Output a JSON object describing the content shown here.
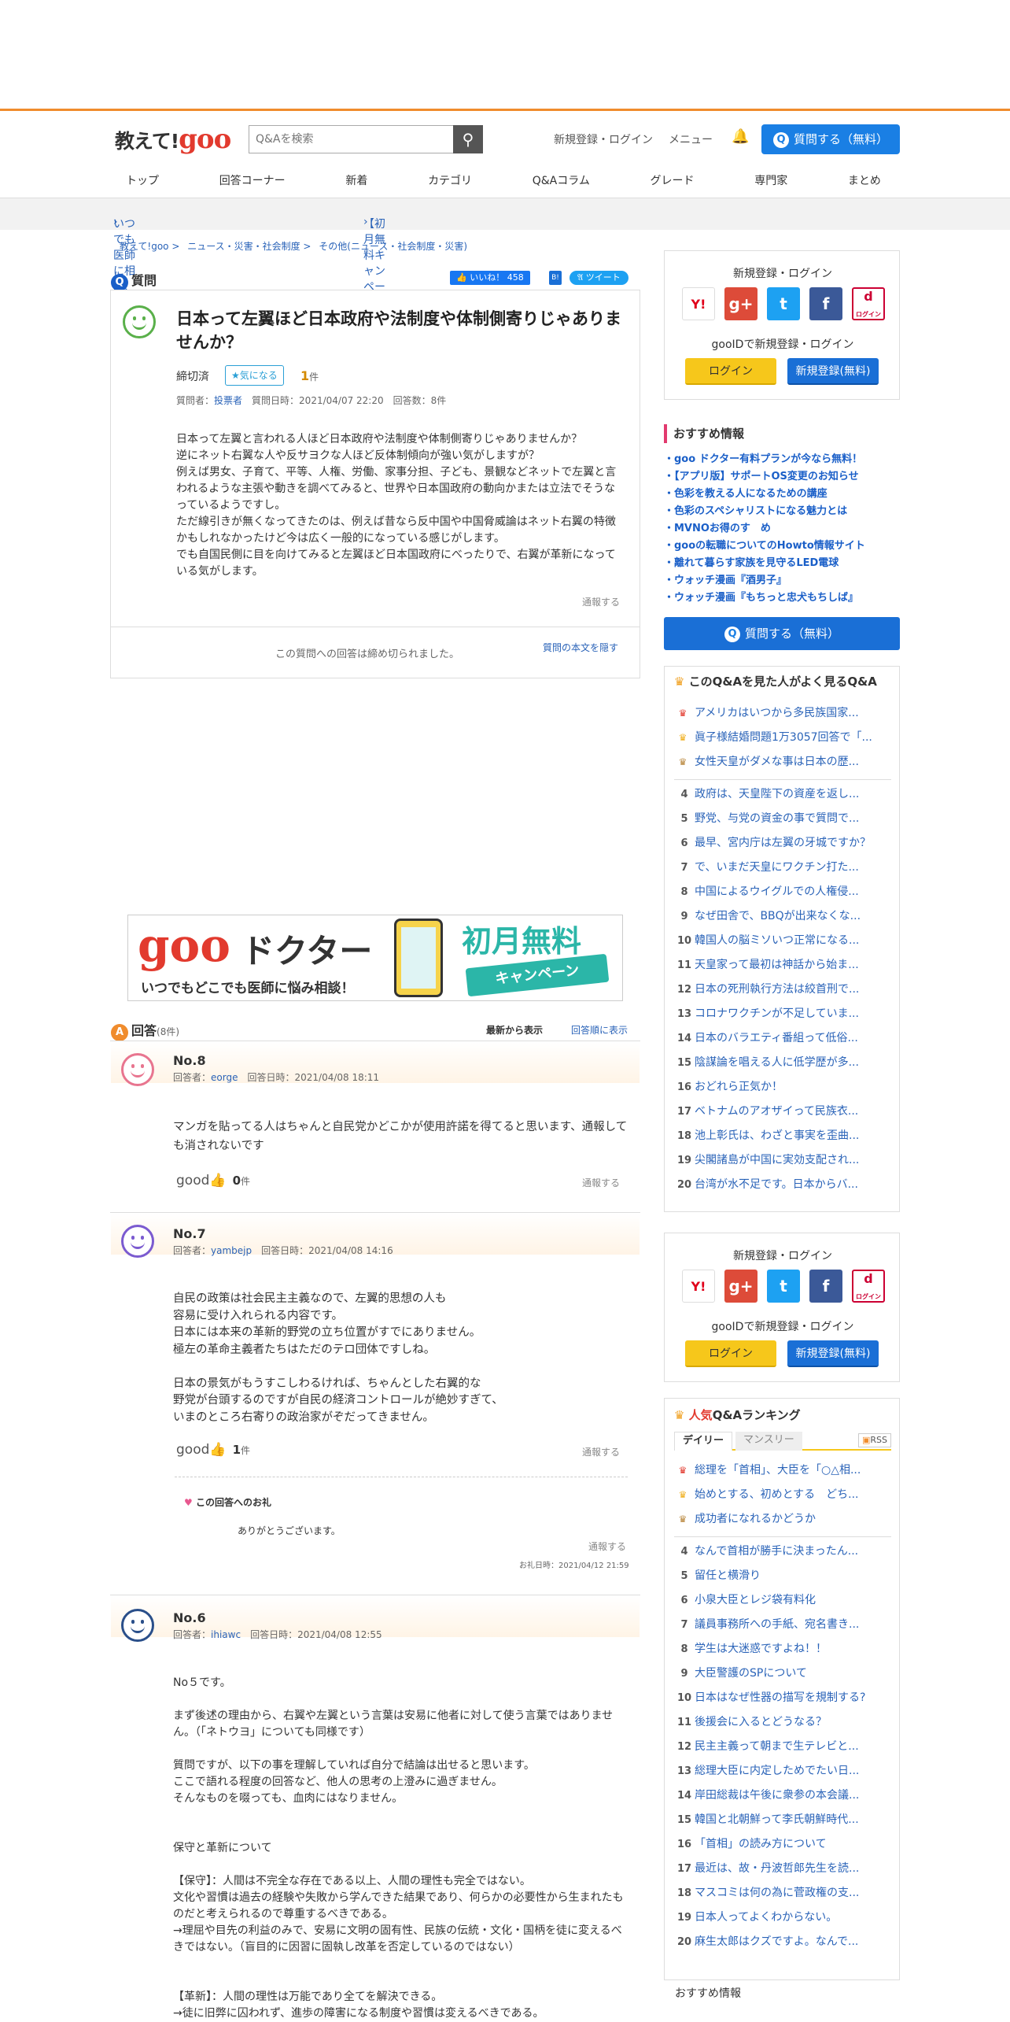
{
  "header": {
    "logo_text": "教えて!",
    "logo_goo": "goo",
    "search_placeholder": "Q&Aを検索",
    "signup_login": "新規登録・ログイン",
    "menu": "メニュー",
    "ask_button": "質問する（無料）"
  },
  "nav": [
    "トップ",
    "回答コーナー",
    "新着",
    "カテゴリ",
    "Q&Aコラム",
    "グレード",
    "専門家",
    "まとめ"
  ],
  "campaign": {
    "left": "いつでも医師に相談、gooドクター",
    "right": "【初月無料キャンペーン中】gooドクター"
  },
  "breadcrumb": [
    "教えて!goo",
    "ニュース・災害・社会制度",
    "その他(ニュース・社会制度・災害)"
  ],
  "question": {
    "section_label": "質問",
    "like_label": "いいね！",
    "like_count": "458",
    "tweet_label": "ツイート",
    "title": "日本って左翼ほど日本政府や法制度や体制側寄りじゃありませんか？",
    "status": "締切済",
    "watch_label": "気になる",
    "watch_count": "1",
    "watch_unit": "件",
    "asker_label": "質問者：",
    "asker": "投票者",
    "date_label": "質問日時：2021/04/07 22:20",
    "answer_count": "回答数：8件",
    "body": "日本って左翼と言われる人ほど日本政府や法制度や体制側寄りじゃありませんか？\n逆にネット右翼な人や反サヨクな人ほど反体制傾向が強い気がしますが？\n例えば男女、子育て、平等、人権、労働、家事分担、子ども、景観などネットで左翼と言われるような主張や動きを調べてみると、世界や日本国政府の動向かまたは立法でそうなっているようですし。\nただ線引きが無くなってきたのは、例えば昔なら反中国や中国脅威論はネット右翼の特徴かもしれなかったけど今は広く一般的になっている感じがします。\nでも自国民側に目を向けてみると左翼ほど日本国政府にべったりで、右翼が革新になっている気がします。",
    "report": "通報する",
    "closed_text": "この質問への回答は締め切られました。",
    "hide_body": "質問の本文を隠す"
  },
  "ad": {
    "brand": "goo",
    "title": "ドクター",
    "sub": "いつでもどこでも医師に悩み相談！",
    "badge": "初月無料",
    "badge2": "キャンペーン"
  },
  "answers_header": {
    "label": "回答",
    "count": "(8件)",
    "sort_new": "最新から表示",
    "sort_order": "回答順に表示"
  },
  "answers": [
    {
      "no": "No.8",
      "responder_label": "回答者：",
      "responder": "eorge",
      "date": "回答日時：2021/04/08 18:11",
      "body": "マンガを貼ってる人はちゃんと自民党かどこかが使用許諾を得てると思います、通報しても消されないです",
      "good_count": "0",
      "unit": "件",
      "report": "通報する"
    },
    {
      "no": "No.7",
      "responder_label": "回答者：",
      "responder": "yambejp",
      "date": "回答日時：2021/04/08 14:16",
      "body": "自民の政策は社会民主主義なので、左翼的思想の人も\n容易に受け入れられる内容です。\n日本には本来の革新的野党の立ち位置がすでにありません。\n極左の革命主義者たちはただのテロ団体ですしね。\n\n日本の景気がもうすこしわるければ、ちゃんとした右翼的な\n野党が台頭するのですが自民の経済コントロールが絶妙すぎて、\nいまのところ右寄りの政治家がぞだってきません。",
      "good_count": "1",
      "unit": "件",
      "report": "通報する",
      "thanks_label": "この回答へのお礼",
      "thanks_body": "ありがとうございます。",
      "thanks_report": "通報する",
      "thanks_date": "お礼日時：2021/04/12 21:59"
    },
    {
      "no": "No.6",
      "responder_label": "回答者：",
      "responder": "ihiawc",
      "date": "回答日時：2021/04/08 12:55",
      "body": "No５です。\n\nまず後述の理由から、右翼や左翼という言葉は安易に他者に対して使う言葉ではありません。（「ネトウヨ」についても同様です）\n\n質問ですが、以下の事を理解していれば自分で結論は出せると思います。\nここで語れる程度の回答など、他人の思考の上澄みに過ぎません。\nそんなものを啜っても、血肉にはなりません。\n\n\n保守と革新について\n\n【保守】：人間は不完全な存在である以上、人間の理性も完全ではない。\n文化や習慣は過去の経験や失敗から学んできた結果であり、何らかの必要性から生まれたものだと考えられるので尊重するべきである。\n→理屈や目先の利益のみで、安易に文明の固有性、民族の伝統・文化・国柄を徒に変えるべきではない。（盲目的に因習に固執し改革を否定しているのではない）\n\n\n【革新】：人間の理性は万能であり全てを解決できる。\n→徒に旧弊に囚われず、進歩の障害になる制度や習慣は変えるべきである。"
    }
  ],
  "sidebar": {
    "login_title": "新規登録・ログイン",
    "gooid_text": "gooIDで新規登録・ログイン",
    "login_btn": "ログイン",
    "register_btn": "新規登録(無料)",
    "social": [
      "Y!",
      "g+",
      "t",
      "f",
      "d"
    ],
    "social_d_sub": "ログイン",
    "rec_title": "おすすめ情報",
    "rec_items": [
      "・goo ドクター有料プランが今なら無料！",
      "・【アプリ版】サポートOS変更のお知らせ",
      "・色彩を教える人になるための講座",
      "・色彩のスペシャリストになる魅力とは",
      "・MVNOお得のす　め",
      "・gooの転職についてのHowto情報サイト",
      "・離れて暮らす家族を見守るLED電球",
      "・ウォッチ漫画『酒男子』",
      "・ウォッチ漫画『もちっと忠犬もちしば』"
    ],
    "ask_button": "質問する（無料）",
    "related_title": "このQ&Aを見た人がよく見るQ&A",
    "related": [
      "アメリカはいつから多民族国家...",
      "眞子様結婚問題1万3057回答で「...",
      "女性天皇がダメな事は日本の歴...",
      "政府は、天皇陛下の資産を返し...",
      "野党、与党の資金の事で質問で...",
      "最早、宮内庁は左翼の牙城ですか？",
      "で、いまだ天皇にワクチン打た...",
      "中国によるウイグルでの人権侵...",
      "なぜ田舎で、BBQが出来なくな...",
      "韓国人の脳ミソいつ正常になる...",
      "天皇家って最初は神話から始ま...",
      "日本の死刑執行方法は絞首刑で...",
      "コロナワクチンが不足していま...",
      "日本のバラエティ番組って低俗...",
      "陰謀論を唱える人に低学歴が多...",
      "おどれら正気か！",
      "ベトナムのアオザイって民族衣...",
      "池上彰氏は、わざと事実を歪曲...",
      "尖閣諸島が中国に実効支配され...",
      "台湾が水不足です。日本からバ..."
    ],
    "ranking_title_accent": "人気",
    "ranking_title": "Q&Aランキング",
    "tab_daily": "デイリー",
    "tab_monthly": "マンスリー",
    "rss": "RSS",
    "ranking": [
      "総理を「首相」、大臣を「○△相...",
      "始めとする、初めとする　どち...",
      "成功者になれるかどうか",
      "なんで首相が勝手に決まったん...",
      "留任と横滑り",
      "小泉大臣とレジ袋有料化",
      "議員事務所への手紙、宛名書き...",
      "学生は大迷惑ですよね！！",
      "大臣警護のSPについて",
      "日本はなぜ性器の描写を規制する?",
      "後援会に入るとどうなる？",
      "民主主義って朝まで生テレビと...",
      "総理大臣に内定しためでたい日...",
      "岸田総裁は午後に衆参の本会議...",
      "韓国と北朝鮮って李氏朝鮮時代...",
      "「首相」の読み方について",
      "最近は、故・丹波哲郎先生を読...",
      "マスコミは何の為に菅政権の支...",
      "日本人ってよくわからない。",
      "麻生太郎はクズですよ。なんで..."
    ],
    "rec2_title": "おすすめ情報"
  },
  "colors": {
    "accent_orange": "#f08c2d",
    "link_blue": "#2a63b8",
    "button_blue": "#1a7fe4",
    "logo_red": "#e23a2e"
  }
}
